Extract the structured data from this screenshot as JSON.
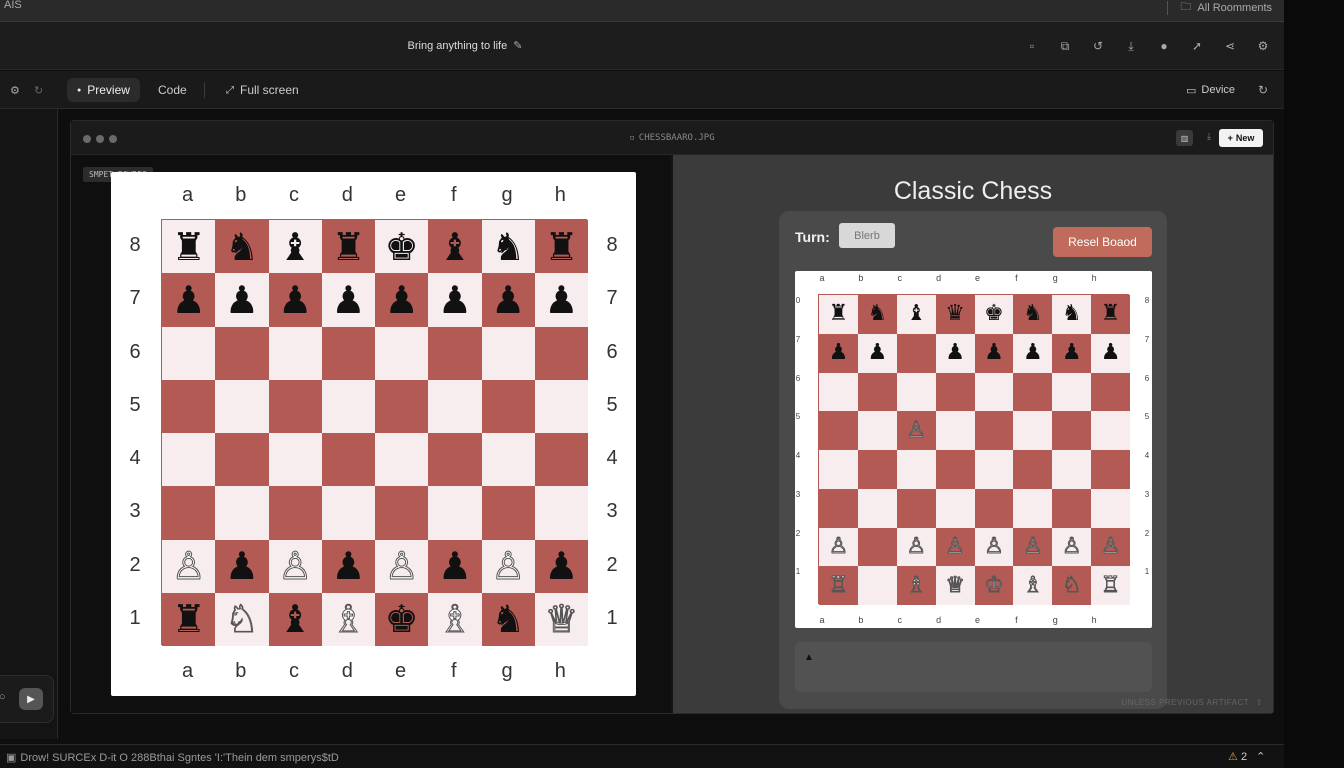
{
  "os": {
    "app_name": "AIS",
    "right_label": "All Roomments"
  },
  "header": {
    "title": "Bring anything to life"
  },
  "toolbar": {
    "preview": "Preview",
    "code": "Code",
    "fullscreen": "Full screen",
    "device": "Device"
  },
  "frame": {
    "filename": "CHESSBAARO.JPG",
    "new_button": "New"
  },
  "left_panel": {
    "tag": "SMPET BOWRES",
    "files": [
      "a",
      "b",
      "c",
      "d",
      "e",
      "f",
      "g",
      "h"
    ],
    "ranks": [
      "8",
      "7",
      "6",
      "5",
      "4",
      "3",
      "2",
      "1"
    ],
    "board": [
      [
        "♜",
        "♞",
        "♝",
        "♜",
        "♚",
        "♝",
        "♞",
        "♜"
      ],
      [
        "♟",
        "♟",
        "♟",
        "♟",
        "♟",
        "♟",
        "♟",
        "♟"
      ],
      [
        "",
        "",
        "",
        "",
        "",
        "",
        "",
        ""
      ],
      [
        "",
        "",
        "",
        "",
        "",
        "",
        "",
        ""
      ],
      [
        "",
        "",
        "",
        "",
        "",
        "",
        "",
        ""
      ],
      [
        "",
        "",
        "",
        "",
        "",
        "",
        "",
        ""
      ],
      [
        "♙",
        "♟",
        "♙",
        "♟",
        "♙",
        "♟",
        "♙",
        "♟"
      ],
      [
        "♜",
        "♘",
        "♝",
        "♗",
        "♚",
        "♗",
        "♞",
        "♕"
      ]
    ]
  },
  "right_panel": {
    "title": "Classic Chess",
    "turn_label": "Turn:",
    "turn_value": "Blerb",
    "reset_button": "Resel Boaod",
    "files": [
      "a",
      "b",
      "c",
      "d",
      "e",
      "f",
      "g",
      "h"
    ],
    "ranks": [
      "0",
      "7",
      "6",
      "5",
      "4",
      "3",
      "2",
      "1"
    ],
    "ranks_right": [
      "8",
      "7",
      "6",
      "5",
      "4",
      "3",
      "2",
      "1"
    ],
    "board": [
      [
        "♜",
        "♞",
        "♝",
        "♛",
        "♚",
        "♞",
        "♞",
        "♜"
      ],
      [
        "♟",
        "♟",
        "",
        "♟",
        "♟",
        "♟",
        "♟",
        "♟"
      ],
      [
        "",
        "",
        "",
        "",
        "",
        "",
        "",
        ""
      ],
      [
        "",
        "",
        "♙",
        "",
        "",
        "",
        "",
        ""
      ],
      [
        "",
        "",
        "",
        "",
        "",
        "",
        "",
        ""
      ],
      [
        "",
        "",
        "",
        "",
        "",
        "",
        "",
        ""
      ],
      [
        "♙",
        "",
        "♙",
        "♙",
        "♙",
        "♙",
        "♙",
        "♙"
      ],
      [
        "♖",
        "",
        "♗",
        "♕",
        "♔",
        "♗",
        "♘",
        "♖"
      ]
    ],
    "status_text": "▲",
    "artifact_label": "UNLESS PREVIOUS ARTIFACT"
  },
  "bottom": {
    "status_text": "Drow! SURCEx D-it O 288Bthai Sgntes 'I:'Thein dem smperys$tD",
    "warnings": "2"
  },
  "colors": {
    "light_square": "#f7ecee",
    "dark_square": "#b35a55",
    "reset_button": "#c06b5b"
  }
}
